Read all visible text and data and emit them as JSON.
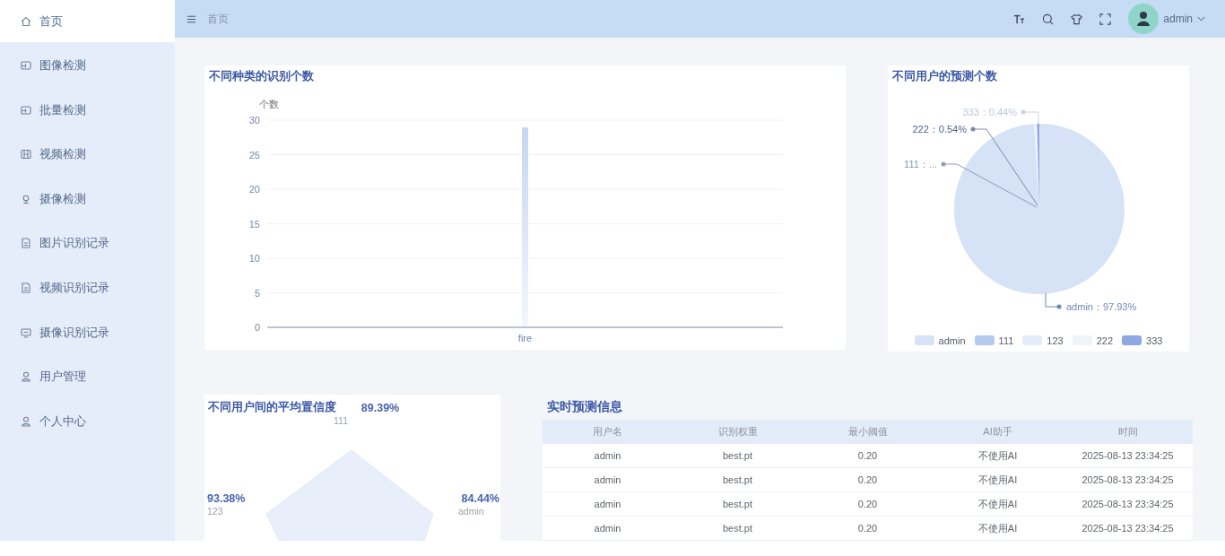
{
  "sidebar": {
    "items": [
      {
        "label": "首页",
        "selected": true
      },
      {
        "label": "图像检测",
        "selected": false
      },
      {
        "label": "批量检测",
        "selected": false
      },
      {
        "label": "视频检测",
        "selected": false
      },
      {
        "label": "摄像检测",
        "selected": false
      },
      {
        "label": "图片识别记录",
        "selected": false
      },
      {
        "label": "视频识别记录",
        "selected": false
      },
      {
        "label": "摄像识别记录",
        "selected": false
      },
      {
        "label": "用户管理",
        "selected": false
      },
      {
        "label": "个人中心",
        "selected": false
      }
    ]
  },
  "header": {
    "breadcrumb": "首页",
    "user": "admin"
  },
  "bar_card": {
    "title": "不同种类的识别个数",
    "chart_data": {
      "type": "bar",
      "categories": [
        "fire"
      ],
      "values": [
        29
      ],
      "ylabel": "个数",
      "ylim": [
        0,
        30
      ],
      "yticks": [
        0,
        5,
        10,
        15,
        20,
        25,
        30
      ],
      "grid": true
    }
  },
  "pie_card": {
    "title": "不同用户的预测个数",
    "chart_data": {
      "type": "pie",
      "categories": [
        "admin",
        "111",
        "123",
        "222",
        "333"
      ],
      "values": [
        97.93,
        null,
        null,
        0.54,
        0.44
      ],
      "annotations": [
        "333：0.44%",
        "222：0.54%",
        "111：...",
        "admin：97.93%"
      ],
      "legend": true
    },
    "slices": [
      {
        "color": "#d6e2f6"
      },
      {
        "color": "#b6caf0"
      },
      {
        "color": "#e3ebf8"
      },
      {
        "color": "#eff3fa"
      },
      {
        "color": "#8fa7e3"
      }
    ]
  },
  "radar_card": {
    "title": "不同用户间的平均置信度",
    "indicators": [
      {
        "name": "111",
        "value": "89.39%"
      },
      {
        "name": "123",
        "value": "93.38%"
      },
      {
        "name": "admin",
        "value": "84.44%"
      }
    ]
  },
  "table": {
    "title": "实时预测信息",
    "columns": [
      "用户名",
      "识别权重",
      "最小阈值",
      "AI助手",
      "时间"
    ],
    "rows": [
      [
        "admin",
        "best.pt",
        "0.20",
        "不使用AI",
        "2025-08-13 23:34:25"
      ],
      [
        "admin",
        "best.pt",
        "0.20",
        "不使用AI",
        "2025-08-13 23:34:25"
      ],
      [
        "admin",
        "best.pt",
        "0.20",
        "不使用AI",
        "2025-08-13 23:34:25"
      ],
      [
        "admin",
        "best.pt",
        "0.20",
        "不使用AI",
        "2025-08-13 23:34:25"
      ]
    ]
  }
}
